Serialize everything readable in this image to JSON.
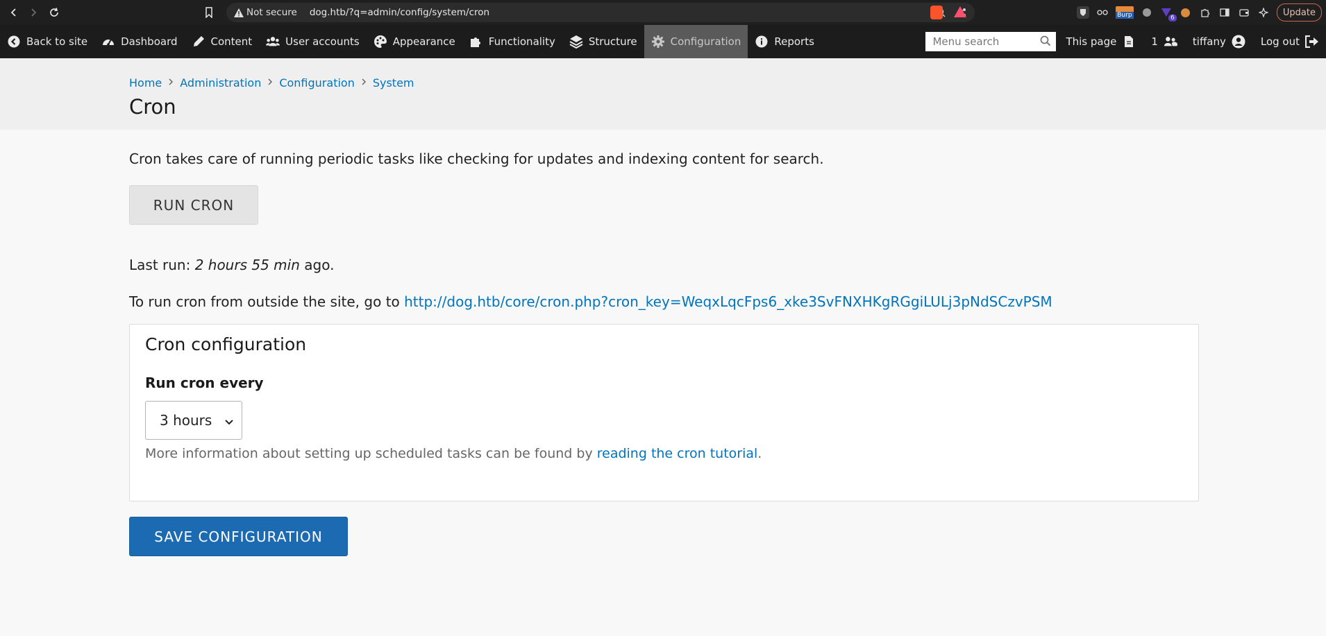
{
  "browser": {
    "security_label": "Not secure",
    "url": "dog.htb/?q=admin/config/system/cron",
    "update_label": "Update",
    "ext_badge_burp": "Burp",
    "ext_badge_count": "6"
  },
  "toolbar": {
    "items": [
      {
        "label": "Back to site",
        "icon": "arrow-left-circle-icon"
      },
      {
        "label": "Dashboard",
        "icon": "dashboard-gauge-icon"
      },
      {
        "label": "Content",
        "icon": "pencil-icon"
      },
      {
        "label": "User accounts",
        "icon": "users-icon"
      },
      {
        "label": "Appearance",
        "icon": "palette-icon"
      },
      {
        "label": "Functionality",
        "icon": "puzzle-icon"
      },
      {
        "label": "Structure",
        "icon": "layers-icon"
      },
      {
        "label": "Configuration",
        "icon": "gear-icon",
        "active": true
      },
      {
        "label": "Reports",
        "icon": "info-icon"
      }
    ],
    "search_placeholder": "Menu search",
    "this_page": "This page",
    "user_count": "1",
    "username": "tiffany",
    "logout": "Log out"
  },
  "breadcrumb": [
    "Home",
    "Administration",
    "Configuration",
    "System"
  ],
  "page_title": "Cron",
  "intro": "Cron takes care of running periodic tasks like checking for updates and indexing content for search.",
  "run_cron_label": "RUN CRON",
  "last_run": {
    "prefix": "Last run: ",
    "value": "2 hours 55 min",
    "suffix": " ago."
  },
  "outside": {
    "prefix": "To run cron from outside the site, go to ",
    "link": "http://dog.htb/core/cron.php?cron_key=WeqxLqcFps6_xke3SvFNXHKgRGgiLULj3pNdSCzvPSM"
  },
  "cron_config": {
    "title": "Cron configuration",
    "field_label": "Run cron every",
    "selected": "3 hours",
    "help_prefix": "More information about setting up scheduled tasks can be found by ",
    "help_link": "reading the cron tutorial",
    "help_suffix": "."
  },
  "save_label": "SAVE CONFIGURATION",
  "colors": {
    "link": "#0074bd",
    "primary_button": "#1c6ab1",
    "toolbar_bg": "#1c1c1c",
    "toolbar_active": "#5a5a5a"
  }
}
